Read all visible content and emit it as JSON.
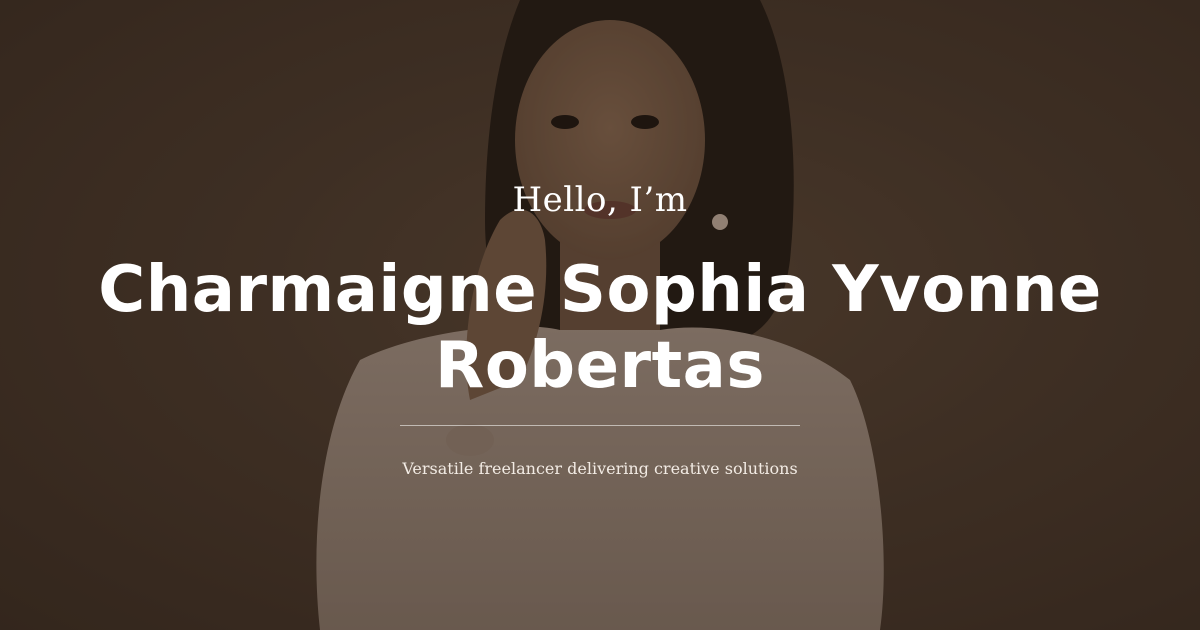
{
  "hero": {
    "greeting": "Hello, I’m",
    "name": "Charmaigne Sophia Yvonne Robertas",
    "tagline": "Versatile freelancer delivering creative solutions"
  },
  "colors": {
    "background": "#3e3127",
    "text": "#ffffff"
  }
}
